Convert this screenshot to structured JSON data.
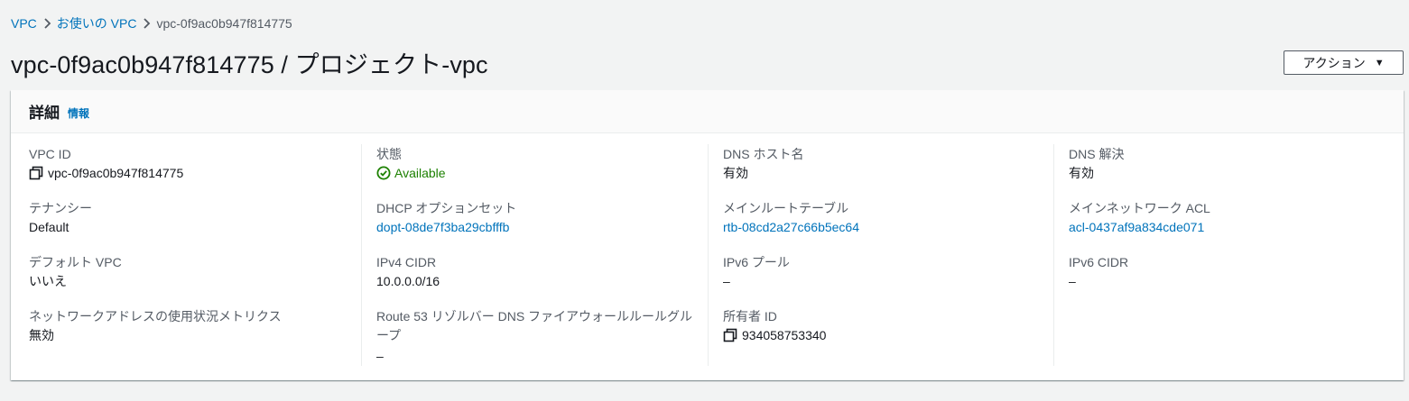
{
  "breadcrumb": {
    "items": [
      "VPC",
      "お使いの VPC"
    ],
    "current": "vpc-0f9ac0b947f814775"
  },
  "title": "vpc-0f9ac0b947f814775 / プロジェクト-vpc",
  "actions": {
    "label": "アクション",
    "caret": "▼"
  },
  "details": {
    "heading": "詳細",
    "info_link": "情報",
    "col1": [
      {
        "label": "VPC ID",
        "value": "vpc-0f9ac0b947f814775"
      },
      {
        "label": "テナンシー",
        "value": "Default"
      },
      {
        "label": "デフォルト VPC",
        "value": "いいえ"
      },
      {
        "label": "ネットワークアドレスの使用状況メトリクス",
        "value": "無効"
      }
    ],
    "col2": [
      {
        "label": "状態",
        "value": "Available"
      },
      {
        "label": "DHCP オプションセット",
        "value": "dopt-08de7f3ba29cbfffb"
      },
      {
        "label": "IPv4 CIDR",
        "value": "10.0.0.0/16"
      },
      {
        "label": "Route 53 リゾルバー DNS ファイアウォールルールグループ",
        "value": "–"
      }
    ],
    "col3": [
      {
        "label": "DNS ホスト名",
        "value": "有効"
      },
      {
        "label": "メインルートテーブル",
        "value": "rtb-08cd2a27c66b5ec64"
      },
      {
        "label": "IPv6 プール",
        "value": "–"
      },
      {
        "label": "所有者 ID",
        "value": "934058753340"
      }
    ],
    "col4": [
      {
        "label": "DNS 解決",
        "value": "有効"
      },
      {
        "label": "メインネットワーク ACL",
        "value": "acl-0437af9a834cde071"
      },
      {
        "label": "IPv6 CIDR",
        "value": "–"
      }
    ]
  },
  "colors": {
    "link": "#0073bb",
    "success": "#1d8102",
    "text": "#16191f",
    "label": "#545b64"
  }
}
